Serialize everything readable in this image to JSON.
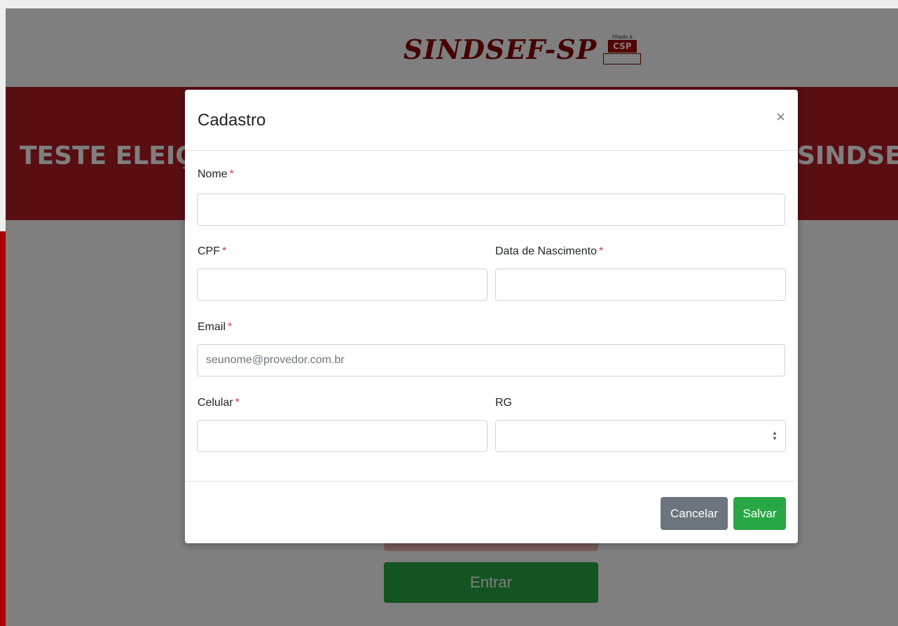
{
  "logo": {
    "text": "SINDSEF-SP",
    "badge_small": "Filiado à",
    "badge_brand": "CSP"
  },
  "banner": {
    "left_text": "TESTE ELEIÇ",
    "right_text": "SINDSE"
  },
  "background_button": {
    "label": "Entrar"
  },
  "modal": {
    "title": "Cadastro",
    "close_symbol": "×",
    "required_marker": "*",
    "fields": {
      "nome": {
        "label": "Nome",
        "value": "",
        "placeholder": ""
      },
      "cpf": {
        "label": "CPF",
        "value": "",
        "placeholder": ""
      },
      "data_nascimento": {
        "label": "Data de Nascimento",
        "value": "",
        "placeholder": ""
      },
      "email": {
        "label": "Email",
        "value": "",
        "placeholder": "seunome@provedor.com.br"
      },
      "celular": {
        "label": "Celular",
        "value": "",
        "placeholder": ""
      },
      "rg": {
        "label": "RG",
        "value": "",
        "placeholder": ""
      }
    },
    "buttons": {
      "cancel": "Cancelar",
      "save": "Salvar"
    }
  },
  "colors": {
    "banner": "#b31d25",
    "cancel": "#6c757d",
    "save": "#28a745",
    "required": "#dc3545"
  }
}
